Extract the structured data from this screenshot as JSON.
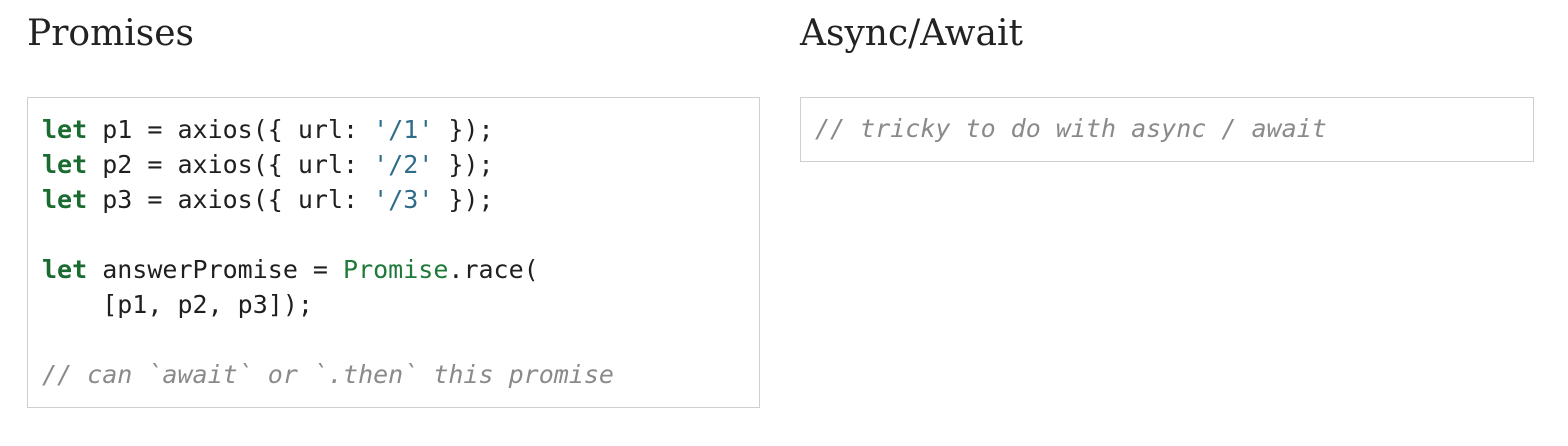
{
  "left": {
    "title": "Promises",
    "code": {
      "line1": {
        "kw": "let",
        "pre": " p1 = axios({ url: ",
        "str": "'/1'",
        "post": " });"
      },
      "line2": {
        "kw": "let",
        "pre": " p2 = axios({ url: ",
        "str": "'/2'",
        "post": " });"
      },
      "line3": {
        "kw": "let",
        "pre": " p3 = axios({ url: ",
        "str": "'/3'",
        "post": " });"
      },
      "line4": {
        "kw": "let",
        "pre": " answerPromise = ",
        "builtin": "Promise",
        "post": ".race("
      },
      "line5": {
        "text": "    [p1, p2, p3]);"
      },
      "line6": {
        "comment": "// can `await` or `.then` this promise"
      }
    }
  },
  "right": {
    "title": "Async/Await",
    "code": {
      "comment": "// tricky to do with async / await"
    }
  }
}
